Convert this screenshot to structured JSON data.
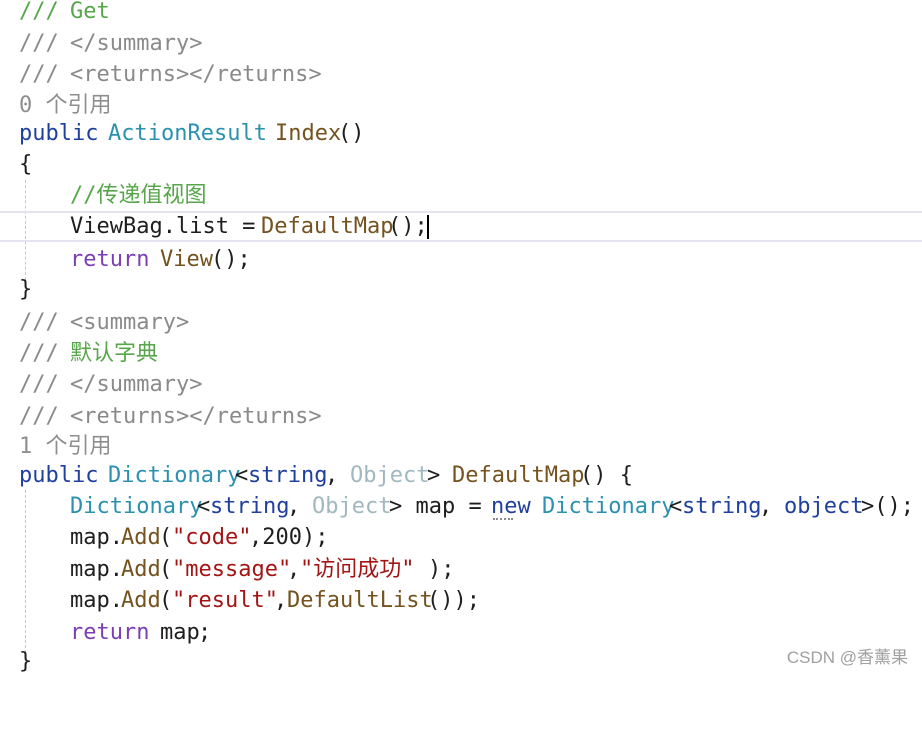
{
  "code": {
    "l1": {
      "a": "/// ",
      "b": "Get"
    },
    "l2": {
      "a": "/// ",
      "b": "</summary>"
    },
    "l3": {
      "a": "/// ",
      "b": "<returns></returns>"
    },
    "l4": {
      "a": "0 个引用"
    },
    "l5": {
      "a": "public ",
      "b": "ActionResult ",
      "c": "Index",
      "d": "()"
    },
    "l6": {
      "a": "{"
    },
    "l7": {
      "a": "//传递值视图"
    },
    "l8": {
      "a": "ViewBag.list = ",
      "b": "DefaultMap",
      "c": "();"
    },
    "l9": {
      "a": "return ",
      "b": "View",
      "c": "();"
    },
    "l10": {
      "a": "}"
    },
    "l11": {
      "a": "/// ",
      "b": "<summary>"
    },
    "l12": {
      "a": "/// ",
      "b": "默认字典"
    },
    "l13": {
      "a": "/// ",
      "b": "</summary>"
    },
    "l14": {
      "a": "/// ",
      "b": "<returns></returns>"
    },
    "l15": {
      "a": "1 个引用"
    },
    "l16": {
      "a": "public ",
      "b": "Dictionary",
      "c": "<",
      "d": "string",
      "e": ", ",
      "f": "Object",
      "g": "> ",
      "h": "DefaultMap",
      "i": "() {"
    },
    "l17": {
      "a": "Dictionary",
      "b": "<",
      "c": "string",
      "d": ", ",
      "e": "Object",
      "f": "> map = ",
      "g": "new",
      "h": " ",
      "i": "Dictionary",
      "j": "<",
      "k": "string",
      "l": ", ",
      "m": "object",
      "n": ">();"
    },
    "l18": {
      "a": "map.",
      "b": "Add",
      "c": "(",
      "d": "\"code\"",
      "e": ",200);"
    },
    "l19": {
      "a": "map.",
      "b": "Add",
      "c": "(",
      "d": "\"message\"",
      "e": ",",
      "f": "\"访问成功\"",
      "g": ");"
    },
    "l20": {
      "a": "map.",
      "b": "Add",
      "c": "(",
      "d": "\"result\"",
      "e": ",",
      "f": "DefaultList",
      "g": "());"
    },
    "l21": {
      "a": "return ",
      "b": "map",
      "c": ";"
    },
    "l22": {
      "a": "}"
    }
  },
  "watermark": "CSDN @香薰果"
}
